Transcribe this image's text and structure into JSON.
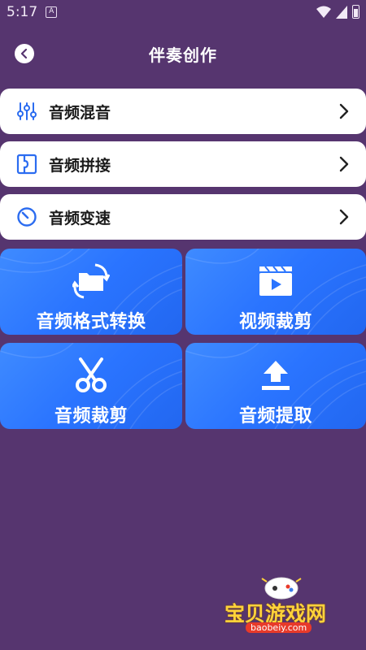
{
  "status_bar": {
    "time": "5:17",
    "notif_glyph": "A"
  },
  "header": {
    "title": "伴奏创作",
    "back_icon": "back-chevron-icon"
  },
  "list_rows": [
    {
      "label": "音频混音",
      "icon": "mixer-sliders-icon"
    },
    {
      "label": "音频拼接",
      "icon": "splice-icon"
    },
    {
      "label": "音频变速",
      "icon": "speed-dial-icon"
    }
  ],
  "tiles": [
    {
      "label": "音频格式转换",
      "icon": "folder-convert-icon"
    },
    {
      "label": "视频裁剪",
      "icon": "video-clapper-icon"
    },
    {
      "label": "音频裁剪",
      "icon": "scissors-icon"
    },
    {
      "label": "音频提取",
      "icon": "upload-icon"
    }
  ],
  "watermark": {
    "text": "宝贝游戏网",
    "domain": "baobeiy.com"
  },
  "colors": {
    "background": "#56356f",
    "row_bg": "#ffffff",
    "tile_blue": "#2a74ff",
    "icon_blue": "#2b6cf0"
  }
}
